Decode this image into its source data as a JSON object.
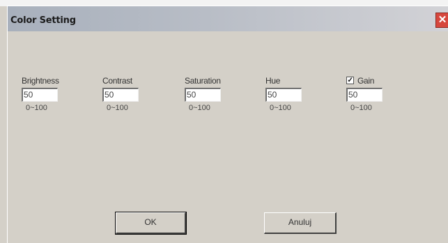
{
  "dialog": {
    "title": "Color Setting",
    "close_glyph": "✕"
  },
  "fields": [
    {
      "label": "Brightness",
      "value": "50",
      "range": "0~100"
    },
    {
      "label": "Contrast",
      "value": "50",
      "range": "0~100"
    },
    {
      "label": "Saturation",
      "value": "50",
      "range": "0~100"
    },
    {
      "label": "Hue",
      "value": "50",
      "range": "0~100"
    },
    {
      "label": "Gain",
      "value": "50",
      "range": "0~100",
      "checkbox_checked": true
    }
  ],
  "buttons": {
    "ok_label": "OK",
    "cancel_label": "Anuluj"
  }
}
